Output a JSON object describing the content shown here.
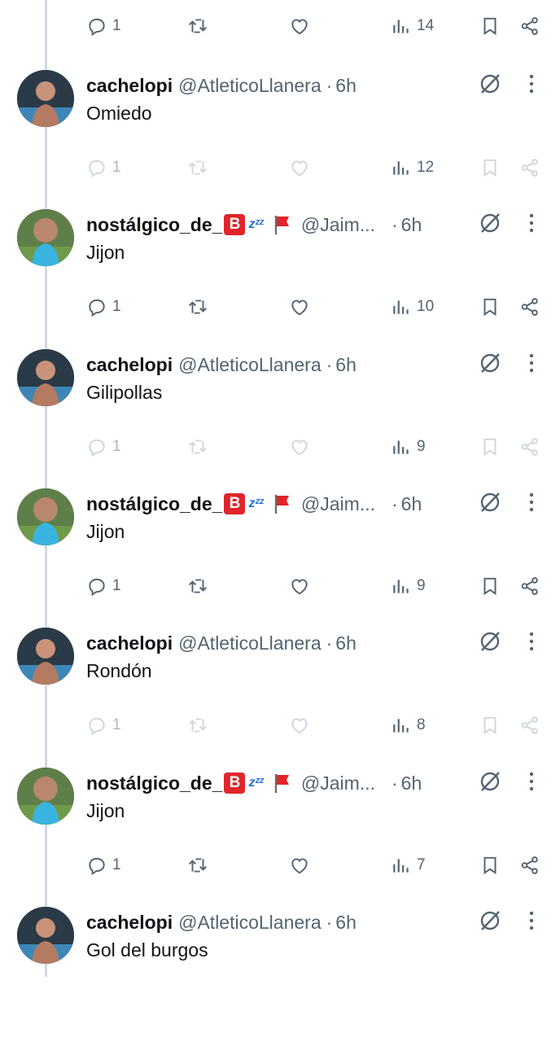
{
  "top_actions": {
    "replies": "1",
    "views": "14"
  },
  "tweets": [
    {
      "name": "cachelopi",
      "handle": "@AtleticoLlanera",
      "sep": "·",
      "time": "6h",
      "text": "Omiedo",
      "replies": "1",
      "views": "12",
      "variant": "cachelopi"
    },
    {
      "name": "nostálgico_de_",
      "handle": "@Jaim...",
      "sep": "·",
      "time": "6h",
      "text": "Jijon",
      "replies": "1",
      "views": "10",
      "variant": "nostalgico",
      "emoji_b": "B",
      "emoji_zzz": "zᶻᶻ"
    },
    {
      "name": "cachelopi",
      "handle": "@AtleticoLlanera",
      "sep": "·",
      "time": "6h",
      "text": "Gilipollas",
      "replies": "1",
      "views": "9",
      "variant": "cachelopi"
    },
    {
      "name": "nostálgico_de_",
      "handle": "@Jaim...",
      "sep": "·",
      "time": "6h",
      "text": "Jijon",
      "replies": "1",
      "views": "9",
      "variant": "nostalgico",
      "emoji_b": "B",
      "emoji_zzz": "zᶻᶻ"
    },
    {
      "name": "cachelopi",
      "handle": "@AtleticoLlanera",
      "sep": "·",
      "time": "6h",
      "text": "Rondón",
      "replies": "1",
      "views": "8",
      "variant": "cachelopi"
    },
    {
      "name": "nostálgico_de_",
      "handle": "@Jaim...",
      "sep": "·",
      "time": "6h",
      "text": "Jijon",
      "replies": "1",
      "views": "7",
      "variant": "nostalgico",
      "emoji_b": "B",
      "emoji_zzz": "zᶻᶻ"
    },
    {
      "name": "cachelopi",
      "handle": "@AtleticoLlanera",
      "sep": "·",
      "time": "6h",
      "text": "Gol del burgos",
      "variant": "cachelopi"
    }
  ],
  "colors": {
    "text": "#0f1419",
    "secondary": "#536471",
    "muted": "#aab8c2",
    "thread_line": "#cfd9de",
    "badge_red": "#e0252b"
  },
  "icons": [
    "reply-icon",
    "retweet-icon",
    "like-icon",
    "views-icon",
    "bookmark-icon",
    "share-icon",
    "grok-icon",
    "more-icon",
    "red-flag-icon"
  ]
}
